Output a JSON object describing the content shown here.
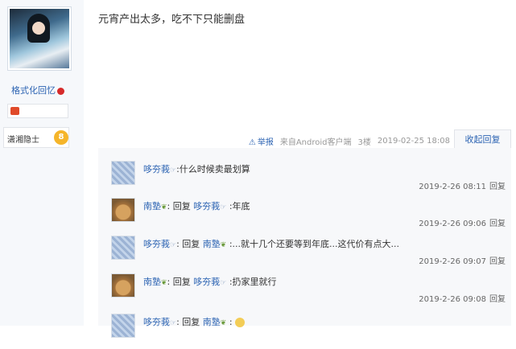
{
  "user": {
    "name": "格式化回忆",
    "level_title": "潇湘隐士",
    "level_num": "8"
  },
  "post": {
    "content": "元宵产出太多，吃不下只能删盘"
  },
  "tail": {
    "report": "举报",
    "source": "来自Android客户端",
    "floor": "3楼",
    "time": "2019-02-25 18:08",
    "toggle": "收起回复"
  },
  "replies": [
    {
      "user": "哆夯莪",
      "mark": "☞",
      "prefix": "",
      "target": "",
      "target_mark": "",
      "colon": ":",
      "text": "什么时候卖最划算",
      "time": "2019-2-26 08:11",
      "reply_btn": "回复",
      "avatar": "blue"
    },
    {
      "user": "南塾",
      "mark": "❦",
      "prefix": ": 回复 ",
      "target": "哆夯莪",
      "target_mark": "☞",
      "colon": " :",
      "text": "年底",
      "time": "2019-2-26 09:06",
      "reply_btn": "回复",
      "avatar": "dog"
    },
    {
      "user": "哆夯莪",
      "mark": "☞",
      "prefix": ": 回复 ",
      "target": "南塾",
      "target_mark": "❦",
      "colon": " :",
      "text": "...就十几个还要等到年底...这代价有点大...",
      "time": "2019-2-26 09:07",
      "reply_btn": "回复",
      "avatar": "blue"
    },
    {
      "user": "南塾",
      "mark": "❦",
      "prefix": ": 回复 ",
      "target": "哆夯莪",
      "target_mark": "☞",
      "colon": " :",
      "text": "扔家里就行",
      "time": "2019-2-26 09:08",
      "reply_btn": "回复",
      "avatar": "dog"
    },
    {
      "user": "哆夯莪",
      "mark": "☞",
      "prefix": ": 回复 ",
      "target": "南塾",
      "target_mark": "❦",
      "colon": " :",
      "text": "",
      "time": "",
      "reply_btn": "",
      "avatar": "blue"
    }
  ]
}
